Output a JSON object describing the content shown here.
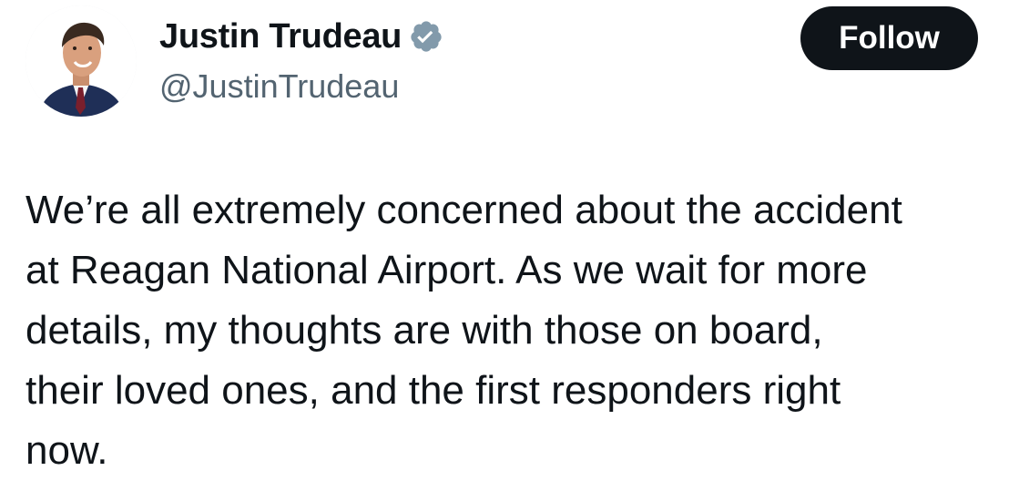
{
  "author": {
    "display_name": "Justin Trudeau",
    "handle": "@JustinTrudeau",
    "verified_badge_icon": "verified-badge-icon",
    "avatar_icon": "profile-photo"
  },
  "actions": {
    "follow_label": "Follow"
  },
  "tweet": {
    "text_lines": [
      "We’re all extremely concerned about the accident",
      "at Reagan National Airport. As we wait for more",
      "details, my thoughts are with those on board,",
      "their loved ones, and the first responders right",
      "now."
    ]
  },
  "colors": {
    "text_primary": "#0f1419",
    "text_secondary": "#536471",
    "verified_badge": "#829aab",
    "follow_button_bg": "#0f1419",
    "follow_button_text": "#ffffff"
  }
}
